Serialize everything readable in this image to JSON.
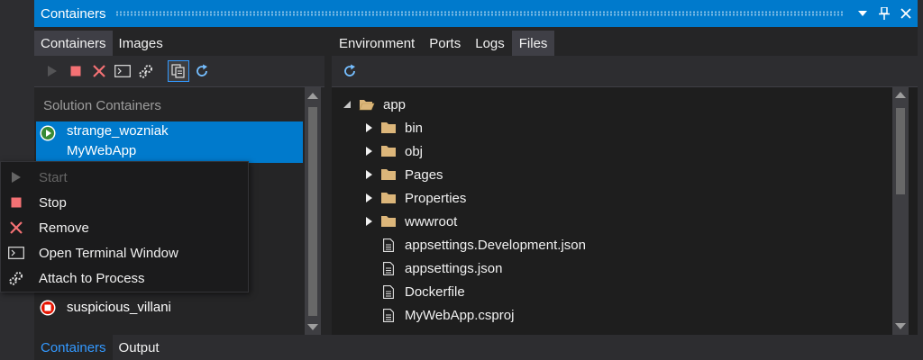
{
  "titlebar": {
    "title": "Containers"
  },
  "left": {
    "tabs": [
      {
        "label": "Containers"
      },
      {
        "label": "Images"
      }
    ],
    "section_header": "Solution Containers",
    "containers": [
      {
        "name": "strange_wozniak",
        "project": "MyWebApp",
        "status": "running"
      },
      {
        "name": "suspicious_villani",
        "status": "stopped"
      }
    ]
  },
  "right": {
    "tabs": [
      {
        "label": "Environment"
      },
      {
        "label": "Ports"
      },
      {
        "label": "Logs"
      },
      {
        "label": "Files"
      }
    ],
    "files": [
      {
        "name": "app",
        "type": "folder-open",
        "expanded": true
      },
      {
        "name": "bin",
        "type": "folder"
      },
      {
        "name": "obj",
        "type": "folder"
      },
      {
        "name": "Pages",
        "type": "folder"
      },
      {
        "name": "Properties",
        "type": "folder"
      },
      {
        "name": "wwwroot",
        "type": "folder"
      },
      {
        "name": "appsettings.Development.json",
        "type": "file"
      },
      {
        "name": "appsettings.json",
        "type": "file"
      },
      {
        "name": "Dockerfile",
        "type": "file"
      },
      {
        "name": "MyWebApp.csproj",
        "type": "file"
      }
    ]
  },
  "context_menu": {
    "items": [
      {
        "label": "Start",
        "icon": "play-icon",
        "disabled": true
      },
      {
        "label": "Stop",
        "icon": "stop-icon"
      },
      {
        "label": "Remove",
        "icon": "remove-icon"
      },
      {
        "label": "Open Terminal Window",
        "icon": "terminal-icon"
      },
      {
        "label": "Attach to Process",
        "icon": "gears-icon"
      }
    ]
  },
  "bottom_tabs": [
    {
      "label": "Containers"
    },
    {
      "label": "Output"
    }
  ],
  "colors": {
    "accent": "#007acc",
    "running": "#388a34",
    "stopped": "#e51400",
    "folder": "#dcb67a"
  }
}
